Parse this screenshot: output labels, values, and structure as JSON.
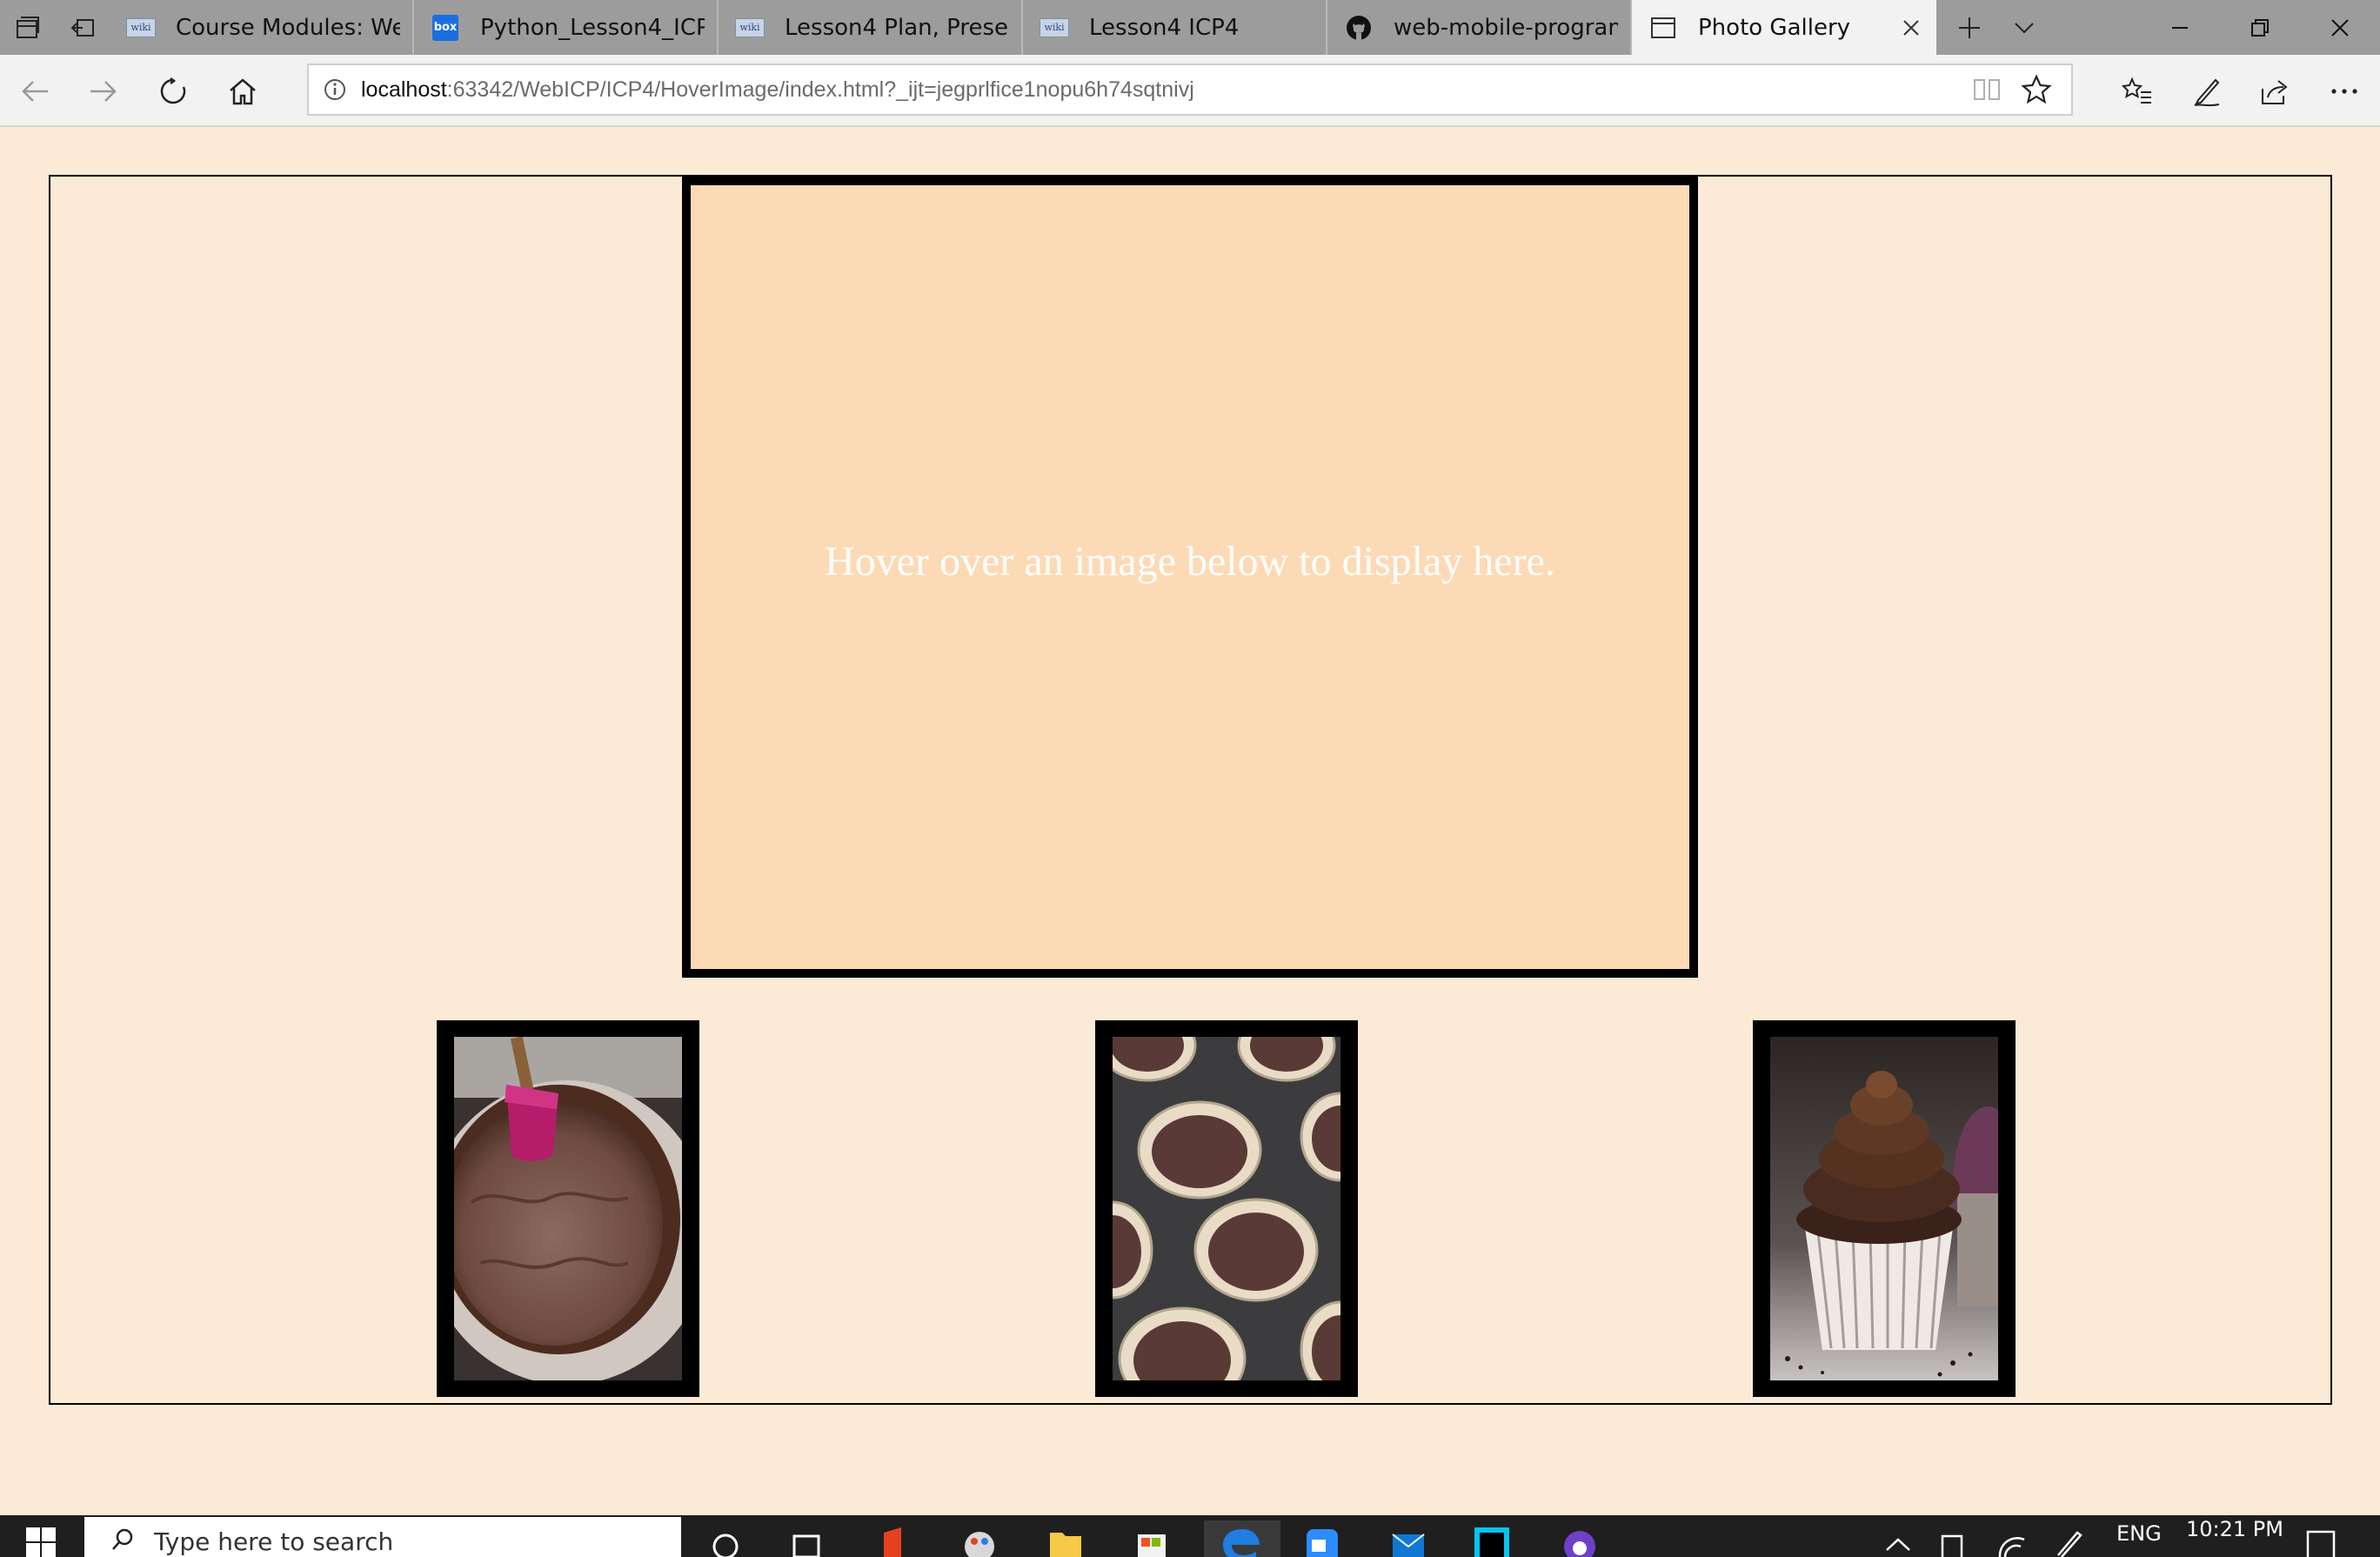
{
  "browser": {
    "tabs": [
      {
        "title": "Course Modules: Web a",
        "icon": "wiki-icon"
      },
      {
        "title": "Python_Lesson4_ICP.dc",
        "icon": "box-icon"
      },
      {
        "title": "Lesson4 Plan, Presentat",
        "icon": "wiki-icon"
      },
      {
        "title": "Lesson4 ICP4",
        "icon": "wiki-icon"
      },
      {
        "title": "web-mobile-programm",
        "icon": "github-icon"
      },
      {
        "title": "Photo Gallery",
        "icon": "page-icon",
        "active": true
      }
    ],
    "wiki_favicon_text": "wiki",
    "box_favicon_text": "box",
    "url_host": "localhost",
    "url_rest": ":63342/WebICP/ICP4/HoverImage/index.html?_ijt=jegprlfice1nopu6h74sqtnivj"
  },
  "page": {
    "preview_text": "Hover over an image below to display here.",
    "thumbnails": [
      {
        "subject": "chocolate batter bowl with pink spatula"
      },
      {
        "subject": "cupcake pan with liners and batter"
      },
      {
        "subject": "frosted chocolate cupcake"
      }
    ]
  },
  "taskbar": {
    "search_placeholder": "Type here to search",
    "language": "ENG",
    "time": "10:21 PM"
  },
  "colors": {
    "page_background": "#fbead6",
    "preview_background": "#fddab6",
    "tabstrip": "#9c9c9c"
  }
}
